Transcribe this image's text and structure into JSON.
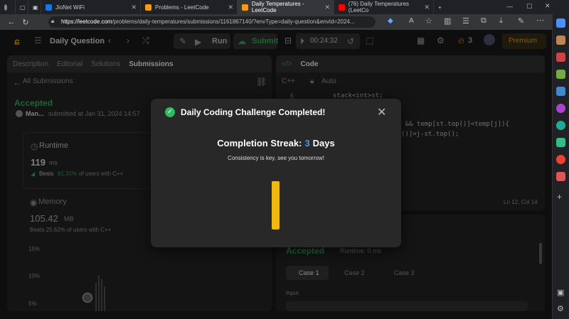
{
  "browser": {
    "tabs": [
      {
        "label": "JioNet WiFi",
        "color": "#1a73e8"
      },
      {
        "label": "Problems - LeetCode",
        "color": "#f39c12"
      },
      {
        "label": "Daily Temperatures - LeetCode",
        "color": "#f39c12",
        "active": true
      },
      {
        "label": "(76) Daily Temperatures (LeetCo",
        "color": "#ff0000"
      }
    ],
    "url_host": "https://leetcode.com",
    "url_path": "/problems/daily-temperatures/submissions/1161867140/?envType=daily-question&envId=2024..."
  },
  "header": {
    "daily_question": "Daily Question",
    "run": "Run",
    "submit": "Submit",
    "timer": "00:24:32",
    "streak_count": "3",
    "premium": "Premium"
  },
  "left_panel": {
    "tabs": [
      "Description",
      "Editorial",
      "Solutions",
      "Submissions"
    ],
    "all_submissions": "All Submissions",
    "status": "Accepted",
    "user": "Man...",
    "submitted_at": "submitted at Jan 31, 2024 14:57",
    "runtime_label": "Runtime",
    "runtime_value": "119",
    "runtime_unit": "ms",
    "beats_runtime_prefix": "Beats",
    "beats_runtime_pct": "61.31%",
    "beats_runtime_suffix": "of users with C++",
    "memory_label": "Memory",
    "memory_value": "105.42",
    "memory_unit": "MB",
    "beats_memory": "Beats 25.62% of users with C++",
    "chart_ticks": [
      "15%",
      "10%",
      "5%"
    ]
  },
  "code_panel": {
    "title": "Code",
    "lang": "C++",
    "mode": "Auto",
    "line_no": "6",
    "line1": "stack<int>st;",
    "line2": "y() && temp[st.top()]<temp[j]){",
    "line3": "()]=j-st.top();",
    "cursor_pos": "Ln 12, Col 14"
  },
  "result_panel": {
    "status": "Accepted",
    "runtime": "Runtime: 0 ms",
    "cases": [
      "Case 1",
      "Case 2",
      "Case 3"
    ],
    "input_label": "Input"
  },
  "modal": {
    "title": "Daily Coding Challenge Completed!",
    "streak_label": "Completion Streak:",
    "streak_value": "3",
    "streak_unit": "Days",
    "subtitle": "Consistency is key, see you tomorrow!"
  }
}
